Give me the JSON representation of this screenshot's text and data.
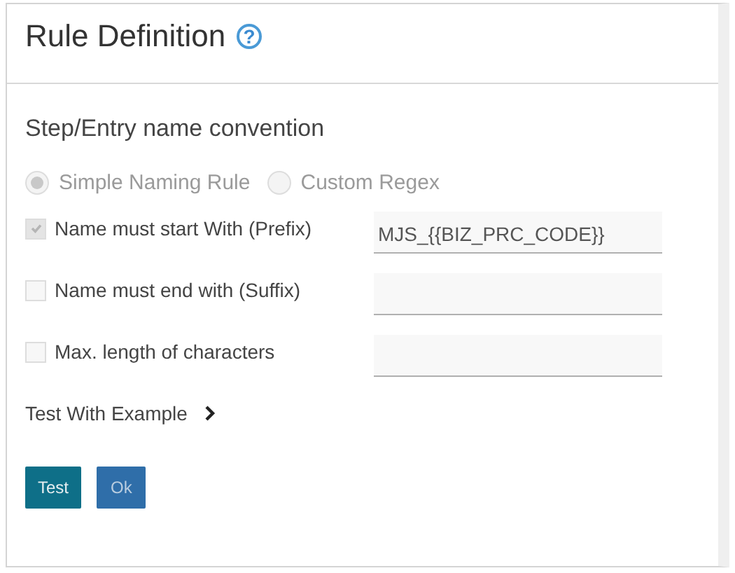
{
  "header": {
    "title": "Rule Definition",
    "help_icon": "?"
  },
  "section_title": "Step/Entry name convention",
  "radios": [
    {
      "label": "Simple Naming Rule",
      "selected": true,
      "disabled": true
    },
    {
      "label": "Custom Regex",
      "selected": false,
      "disabled": true
    }
  ],
  "rules": [
    {
      "label": "Name must start With (Prefix)",
      "checked": true,
      "disabled": true,
      "value": "MJS_{{BIZ_PRC_CODE}}"
    },
    {
      "label": "Name must end with (Suffix)",
      "checked": false,
      "disabled": false
    },
    {
      "label": "Max. length of characters",
      "checked": false,
      "disabled": false
    }
  ],
  "test_with_example": {
    "label": "Test With Example",
    "expanded": false
  },
  "buttons": [
    {
      "label": "Test",
      "kind": "primary"
    },
    {
      "label": "Ok",
      "kind": "secondary"
    }
  ]
}
